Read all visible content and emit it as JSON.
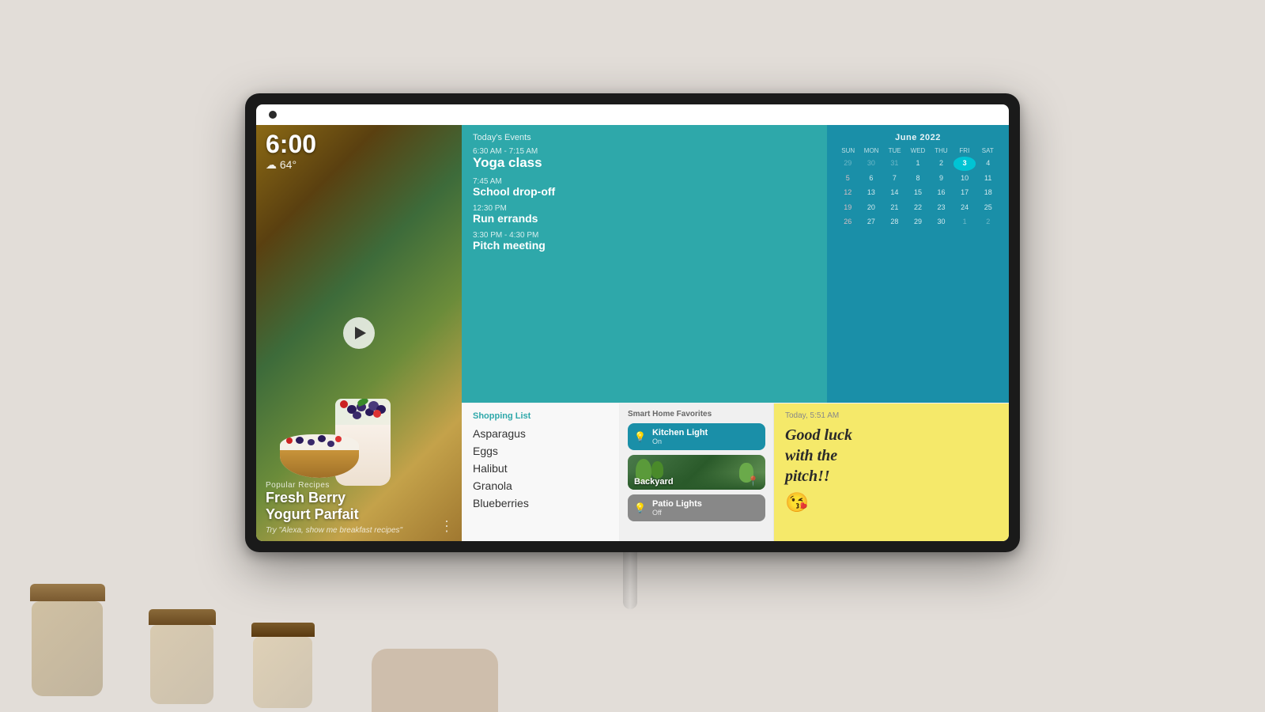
{
  "device": {
    "time": "6:00",
    "weather": "☁ 64°"
  },
  "recipe": {
    "popular_label": "Popular Recipes",
    "title_line1": "Fresh Berry",
    "title_line2": "Yogurt Parfait",
    "alexa_tip": "Try \"Alexa, show me breakfast recipes\""
  },
  "events": {
    "section_title": "Today's Events",
    "items": [
      {
        "time": "6:30 AM - 7:15 AM",
        "name": "Yoga class"
      },
      {
        "time": "7:45 AM",
        "name": "School drop-off"
      },
      {
        "time": "12:30 PM",
        "name": "Run errands"
      },
      {
        "time": "3:30 PM - 4:30 PM",
        "name": "Pitch meeting"
      }
    ]
  },
  "calendar": {
    "month_year": "June 2022",
    "day_labels": [
      "SUN",
      "MON",
      "TUE",
      "WED",
      "THU",
      "FRI",
      "SAT"
    ],
    "weeks": [
      [
        "29",
        "30",
        "31",
        "1",
        "2",
        "3",
        "4"
      ],
      [
        "5",
        "6",
        "7",
        "8",
        "9",
        "10",
        "11"
      ],
      [
        "12",
        "13",
        "14",
        "15",
        "16",
        "17",
        "18"
      ],
      [
        "19",
        "20",
        "21",
        "22",
        "23",
        "24",
        "25"
      ],
      [
        "26",
        "27",
        "28",
        "29",
        "30",
        "1",
        "2"
      ]
    ],
    "today": "3"
  },
  "shopping": {
    "title": "Shopping List",
    "items": [
      "Asparagus",
      "Eggs",
      "Halibut",
      "Granola",
      "Blueberries"
    ]
  },
  "smarthome": {
    "title": "Smart Home Favorites",
    "devices": [
      {
        "name": "Kitchen Light",
        "status": "On",
        "active": true
      },
      {
        "name": "Backyard",
        "status": "",
        "active": false,
        "is_image": true
      },
      {
        "name": "Patio Lights",
        "status": "Off",
        "active": false
      }
    ]
  },
  "sticky": {
    "time": "Today, 5:51 AM",
    "message_line1": "Good luck",
    "message_line2": "with the",
    "message_line3": "pitch!!",
    "emoji": "😘"
  }
}
